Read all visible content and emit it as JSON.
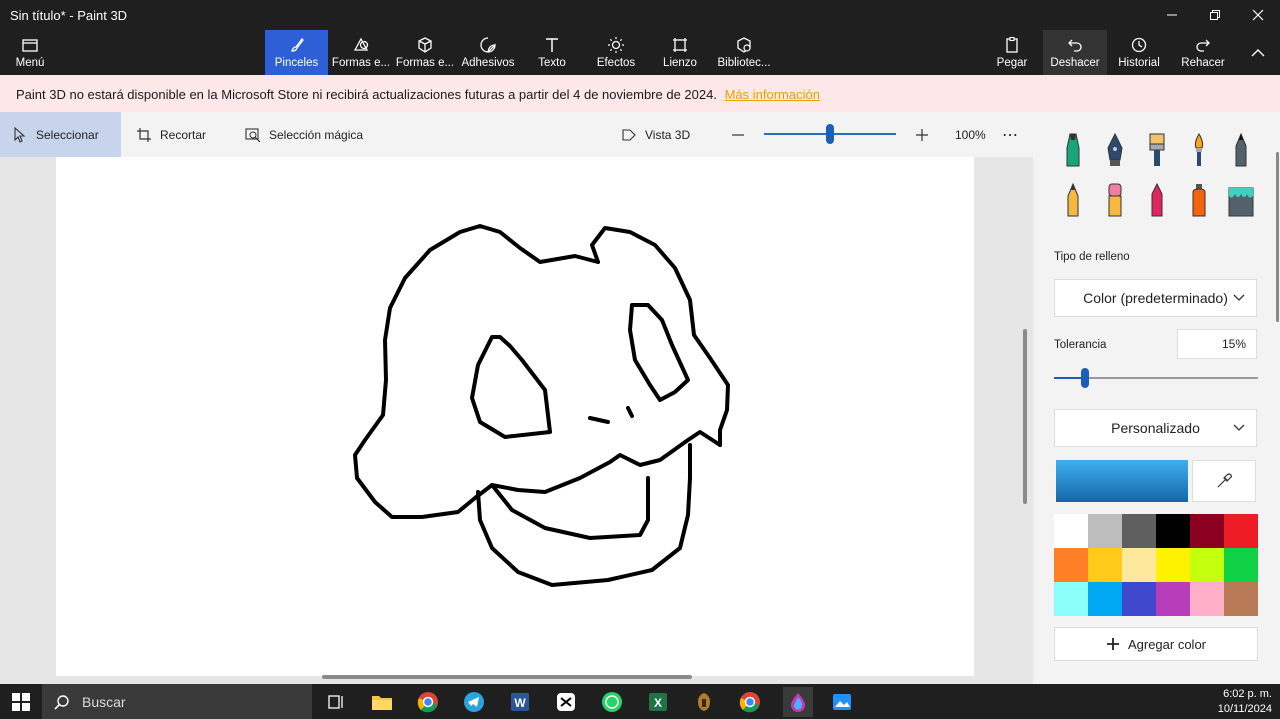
{
  "window": {
    "title": "Sin título* - Paint 3D"
  },
  "ribbon": {
    "menu": "Menú",
    "items": [
      {
        "label": "Pinceles",
        "icon": "brush-icon"
      },
      {
        "label": "Formas e...",
        "icon": "shapes-icon"
      },
      {
        "label": "Formas e...",
        "icon": "cube-icon"
      },
      {
        "label": "Adhesivos",
        "icon": "sticker-icon"
      },
      {
        "label": "Texto",
        "icon": "text-icon"
      },
      {
        "label": "Efectos",
        "icon": "sun-icon"
      },
      {
        "label": "Lienzo",
        "icon": "canvas-icon"
      },
      {
        "label": "Bibliotec...",
        "icon": "library-icon"
      }
    ],
    "right": [
      {
        "label": "Pegar",
        "icon": "paste-icon"
      },
      {
        "label": "Deshacer",
        "icon": "undo-icon"
      },
      {
        "label": "Historial",
        "icon": "history-icon"
      },
      {
        "label": "Rehacer",
        "icon": "redo-icon"
      }
    ]
  },
  "notice": {
    "text": "Paint 3D no estará disponible en la Microsoft Store ni recibirá actualizaciones futuras a partir del 4 de noviembre de 2024.",
    "link": "Más información",
    "link_color": "#e8a300"
  },
  "toolbar": {
    "select": "Seleccionar",
    "crop": "Recortar",
    "magic": "Selección mágica",
    "view3d": "Vista 3D",
    "zoom": "100%",
    "zoom_level": 0.5
  },
  "panel": {
    "fill_type_label": "Tipo de relleno",
    "fill_type_value": "Color (predeterminado)",
    "tolerance_label": "Tolerancia",
    "tolerance_value": "15%",
    "tolerance_level": 0.15,
    "custom": "Personalizado",
    "add_color": "Agregar color",
    "palette": [
      "#ffffff",
      "#bdbdbd",
      "#5f5f5f",
      "#000000",
      "#8b0021",
      "#ee1c24",
      "#ff7f27",
      "#ffca18",
      "#fde89b",
      "#fff200",
      "#c4ff0e",
      "#0ed145",
      "#8cfffb",
      "#00a8f3",
      "#3f48cc",
      "#b83dba",
      "#ffaec8",
      "#b97a56"
    ]
  },
  "taskbar": {
    "search": "Buscar",
    "time": "6:02 p. m.",
    "date": "10/11/2024"
  }
}
